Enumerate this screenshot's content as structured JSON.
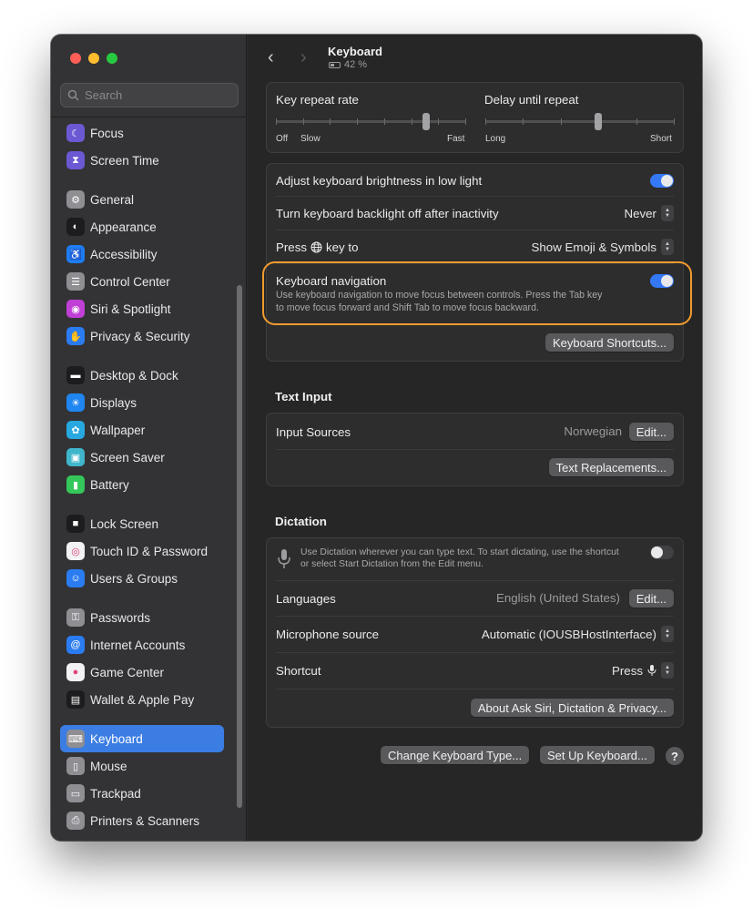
{
  "search": {
    "placeholder": "Search"
  },
  "sidebar": {
    "items": [
      {
        "label": "Focus",
        "icon": "moon-icon",
        "color": "#6b59d3"
      },
      {
        "label": "Screen Time",
        "icon": "hourglass-icon",
        "color": "#6b59d3"
      },
      {
        "label": "General",
        "icon": "gear-icon",
        "color": "#8e8e93"
      },
      {
        "label": "Appearance",
        "icon": "appearance-icon",
        "color": "#1c1c1e"
      },
      {
        "label": "Accessibility",
        "icon": "accessibility-icon",
        "color": "#1e7cf2"
      },
      {
        "label": "Control Center",
        "icon": "control-center-icon",
        "color": "#8e8e93"
      },
      {
        "label": "Siri & Spotlight",
        "icon": "siri-icon",
        "color": "#c03fd6"
      },
      {
        "label": "Privacy & Security",
        "icon": "hand-icon",
        "color": "#2b7cf0"
      },
      {
        "label": "Desktop & Dock",
        "icon": "dock-icon",
        "color": "#1c1c1e"
      },
      {
        "label": "Displays",
        "icon": "sun-icon",
        "color": "#1f85f0"
      },
      {
        "label": "Wallpaper",
        "icon": "flower-icon",
        "color": "#27a9e0"
      },
      {
        "label": "Screen Saver",
        "icon": "screensaver-icon",
        "color": "#3fb6cc"
      },
      {
        "label": "Battery",
        "icon": "battery-icon",
        "color": "#34c759"
      },
      {
        "label": "Lock Screen",
        "icon": "lock-icon",
        "color": "#1c1c1e"
      },
      {
        "label": "Touch ID & Password",
        "icon": "fingerprint-icon",
        "color": "#f2f2f4"
      },
      {
        "label": "Users & Groups",
        "icon": "users-icon",
        "color": "#2b7cf0"
      },
      {
        "label": "Passwords",
        "icon": "key-icon",
        "color": "#8e8e93"
      },
      {
        "label": "Internet Accounts",
        "icon": "at-icon",
        "color": "#2b7cf0"
      },
      {
        "label": "Game Center",
        "icon": "game-center-icon",
        "color": "#f2f2f4"
      },
      {
        "label": "Wallet & Apple Pay",
        "icon": "wallet-icon",
        "color": "#1c1c1e"
      },
      {
        "label": "Keyboard",
        "icon": "keyboard-icon",
        "color": "#8e8e93"
      },
      {
        "label": "Mouse",
        "icon": "mouse-icon",
        "color": "#8e8e93"
      },
      {
        "label": "Trackpad",
        "icon": "trackpad-icon",
        "color": "#8e8e93"
      },
      {
        "label": "Printers & Scanners",
        "icon": "printer-icon",
        "color": "#8e8e93"
      }
    ],
    "selected": "Keyboard"
  },
  "header": {
    "title": "Keyboard",
    "subtitle": "42 %"
  },
  "repeat": {
    "key_repeat_label": "Key repeat rate",
    "delay_label": "Delay until repeat",
    "off": "Off",
    "slow": "Slow",
    "fast": "Fast",
    "long": "Long",
    "short": "Short",
    "key_repeat_level": 0.8,
    "delay_level": 0.6
  },
  "keyboard_settings": {
    "brightness_label": "Adjust keyboard brightness in low light",
    "brightness_on": true,
    "backlight_label": "Turn keyboard backlight off after inactivity",
    "backlight_value": "Never",
    "press_prefix": "Press",
    "press_suffix": "key to",
    "press_value": "Show Emoji & Symbols",
    "nav_label": "Keyboard navigation",
    "nav_desc_1": "Use keyboard navigation to move focus between controls. Press the Tab key",
    "nav_desc_2": "to move focus forward and Shift Tab to move focus backward.",
    "nav_on": true,
    "shortcuts_button": "Keyboard Shortcuts..."
  },
  "text_input": {
    "title": "Text Input",
    "sources_label": "Input Sources",
    "sources_value": "Norwegian",
    "edit_button": "Edit...",
    "replacements_button": "Text Replacements..."
  },
  "dictation": {
    "title": "Dictation",
    "desc_1": "Use Dictation wherever you can type text. To start dictating, use the shortcut",
    "desc_2": "or select Start Dictation from the Edit menu.",
    "dictation_on": false,
    "languages_label": "Languages",
    "languages_value": "English (United States)",
    "edit_button": "Edit...",
    "mic_label": "Microphone source",
    "mic_value": "Automatic (IOUSBHostInterface)",
    "shortcut_label": "Shortcut",
    "shortcut_value": "Press",
    "about_button": "About Ask Siri, Dictation & Privacy..."
  },
  "footer": {
    "change_type_button": "Change Keyboard Type...",
    "setup_button": "Set Up Keyboard...",
    "help_label": "?"
  },
  "colors": {
    "accent": "#3b7de3",
    "highlight": "#f09a2e"
  }
}
